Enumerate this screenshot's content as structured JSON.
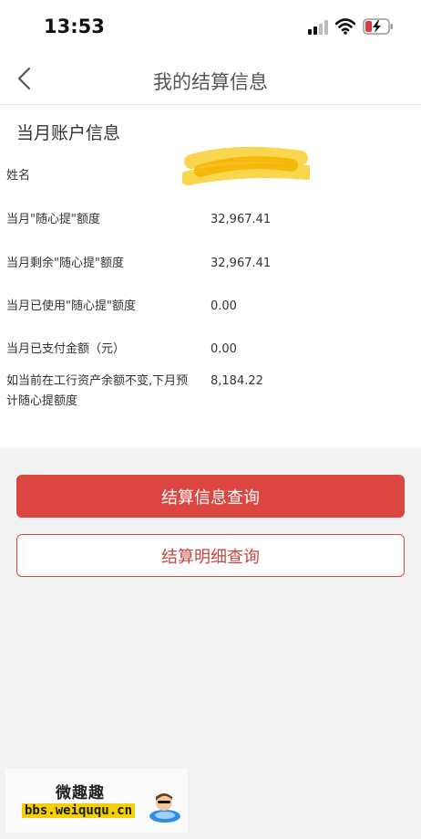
{
  "status_bar": {
    "time": "13:53"
  },
  "header": {
    "title": "我的结算信息"
  },
  "account": {
    "section_title": "当月账户信息",
    "rows": [
      {
        "label": "姓名",
        "value": ""
      },
      {
        "label": "当月\"随心提\"额度",
        "value": "32,967.41"
      },
      {
        "label": "当月剩余\"随心提\"额度",
        "value": "32,967.41"
      },
      {
        "label": "当月已使用\"随心提\"额度",
        "value": "0.00"
      },
      {
        "label": "当月已支付金额（元）",
        "value": "0.00"
      },
      {
        "label": "如当前在工行资产余额不变,下月预计随心提额度",
        "value": "8,184.22"
      }
    ]
  },
  "buttons": {
    "query_label": "结算信息查询",
    "detail_label": "结算明细查询"
  },
  "watermark": {
    "title": "微趣趣",
    "url": "bbs.weiququ.cn"
  },
  "colors": {
    "accent": "#dc4640",
    "background": "#f2f2f2"
  }
}
